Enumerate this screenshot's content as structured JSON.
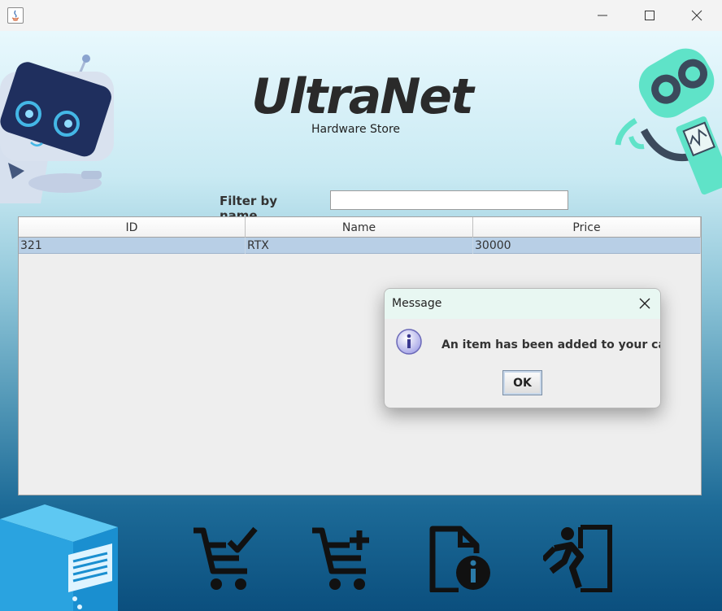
{
  "window": {
    "controls": [
      "minimize-icon",
      "maximize-icon",
      "close-icon"
    ]
  },
  "header": {
    "title": "UltraNet",
    "subtitle": "Hardware Store"
  },
  "filter": {
    "label": "Filter by name",
    "value": "",
    "placeholder": ""
  },
  "table": {
    "columns": [
      "ID",
      "Name",
      "Price"
    ],
    "rows": [
      [
        "321",
        "RTX",
        "30000"
      ]
    ],
    "selected_row": 0
  },
  "dialog": {
    "title": "Message",
    "message": "An item has been added to your cart!",
    "ok_label": "OK",
    "icon": "info-icon"
  },
  "toolbar": {
    "items": [
      "cart-check-icon",
      "cart-add-icon",
      "file-info-icon",
      "exit-icon"
    ]
  },
  "colors": {
    "accent_bg_top": "#e8f8fd",
    "accent_bg_bottom": "#0b4f7e",
    "row_selected": "#b8cfe6",
    "robot_left": "#1f2f5e",
    "robot_right": "#5fe3c8"
  }
}
